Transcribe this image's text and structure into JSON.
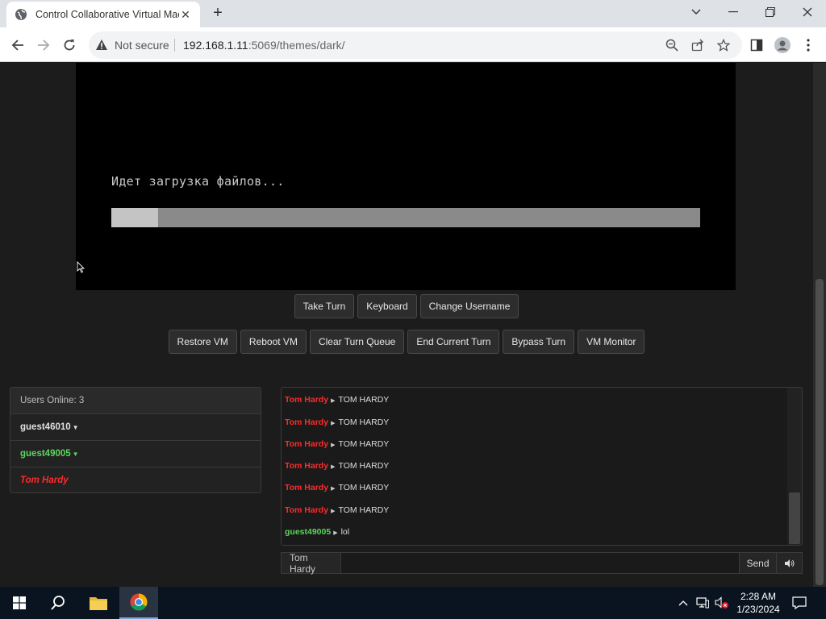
{
  "browser": {
    "tab_title": "Control Collaborative Virtual Mac",
    "security_label": "Not secure",
    "url_host": "192.168.1.11",
    "url_rest": ":5069/themes/dark/"
  },
  "vm": {
    "status_text": "Идет загрузка файлов...",
    "progress": 0.08
  },
  "controls": {
    "primary": [
      "Take Turn",
      "Keyboard",
      "Change Username"
    ],
    "admin": [
      "Restore VM",
      "Reboot VM",
      "Clear Turn Queue",
      "End Current Turn",
      "Bypass Turn",
      "VM Monitor"
    ]
  },
  "users": {
    "header": "Users Online: 3",
    "list": [
      {
        "name": "guest46010",
        "color": "#e0e0e0",
        "caret": true,
        "italic": false
      },
      {
        "name": "guest49005",
        "color": "#5cd65c",
        "caret": true,
        "italic": false
      },
      {
        "name": "Tom Hardy",
        "color": "#ff2a2a",
        "caret": false,
        "italic": true
      }
    ]
  },
  "chat": {
    "messages": [
      {
        "user": "Tom Hardy",
        "color": "#ff2a2a",
        "text": "TOM HARDY"
      },
      {
        "user": "Tom Hardy",
        "color": "#ff2a2a",
        "text": "TOM HARDY"
      },
      {
        "user": "Tom Hardy",
        "color": "#ff2a2a",
        "text": "TOM HARDY"
      },
      {
        "user": "Tom Hardy",
        "color": "#ff2a2a",
        "text": "TOM HARDY"
      },
      {
        "user": "Tom Hardy",
        "color": "#ff2a2a",
        "text": "TOM HARDY"
      },
      {
        "user": "Tom Hardy",
        "color": "#ff2a2a",
        "text": "TOM HARDY"
      },
      {
        "user": "guest49005",
        "color": "#5cd65c",
        "text": "lol"
      }
    ],
    "username_label": "Tom Hardy",
    "send_label": "Send"
  },
  "taskbar": {
    "time": "2:28 AM",
    "date": "1/23/2024"
  },
  "icons": [
    "globe-icon",
    "warning-icon",
    "zoom-icon",
    "share-icon",
    "star-icon",
    "sidepanel-icon",
    "profile-icon",
    "menu-icon",
    "speaker-icon",
    "windows-icon",
    "search-icon",
    "folder-icon",
    "chrome-icon"
  ]
}
